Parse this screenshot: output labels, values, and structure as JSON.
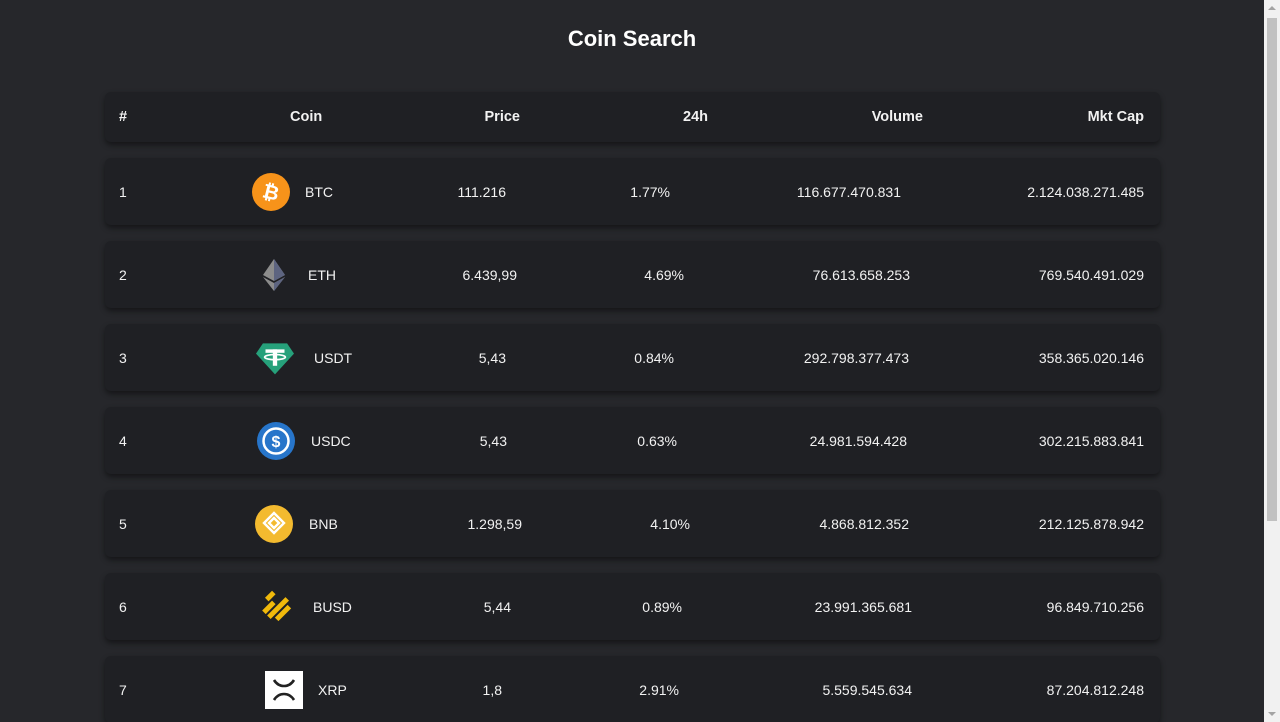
{
  "page": {
    "title": "Coin Search"
  },
  "table": {
    "headers": {
      "rank": "#",
      "coin": "Coin",
      "price": "Price",
      "change": "24h",
      "volume": "Volume",
      "mktcap": "Mkt Cap"
    },
    "rows": [
      {
        "rank": "1",
        "symbol": "BTC",
        "icon": "bitcoin-icon",
        "price": "111.216",
        "change": "1.77%",
        "volume": "116.677.470.831",
        "mktcap": "2.124.038.271.485"
      },
      {
        "rank": "2",
        "symbol": "ETH",
        "icon": "ethereum-icon",
        "price": "6.439,99",
        "change": "4.69%",
        "volume": "76.613.658.253",
        "mktcap": "769.540.491.029"
      },
      {
        "rank": "3",
        "symbol": "USDT",
        "icon": "tether-icon",
        "price": "5,43",
        "change": "0.84%",
        "volume": "292.798.377.473",
        "mktcap": "358.365.020.146"
      },
      {
        "rank": "4",
        "symbol": "USDC",
        "icon": "usdc-icon",
        "price": "5,43",
        "change": "0.63%",
        "volume": "24.981.594.428",
        "mktcap": "302.215.883.841"
      },
      {
        "rank": "5",
        "symbol": "BNB",
        "icon": "bnb-icon",
        "price": "1.298,59",
        "change": "4.10%",
        "volume": "4.868.812.352",
        "mktcap": "212.125.878.942"
      },
      {
        "rank": "6",
        "symbol": "BUSD",
        "icon": "busd-icon",
        "price": "5,44",
        "change": "0.89%",
        "volume": "23.991.365.681",
        "mktcap": "96.849.710.256"
      },
      {
        "rank": "7",
        "symbol": "XRP",
        "icon": "xrp-icon",
        "price": "1,8",
        "change": "2.91%",
        "volume": "5.559.545.634",
        "mktcap": "87.204.812.248"
      }
    ]
  },
  "colors": {
    "background": "#26272b",
    "card": "#1f2024",
    "btc": "#f7931a",
    "eth": "#627eea",
    "usdt": "#26a17b",
    "usdc": "#2775ca",
    "bnb": "#f3ba2f",
    "busd": "#f0b90b",
    "xrp": "#ffffff"
  }
}
